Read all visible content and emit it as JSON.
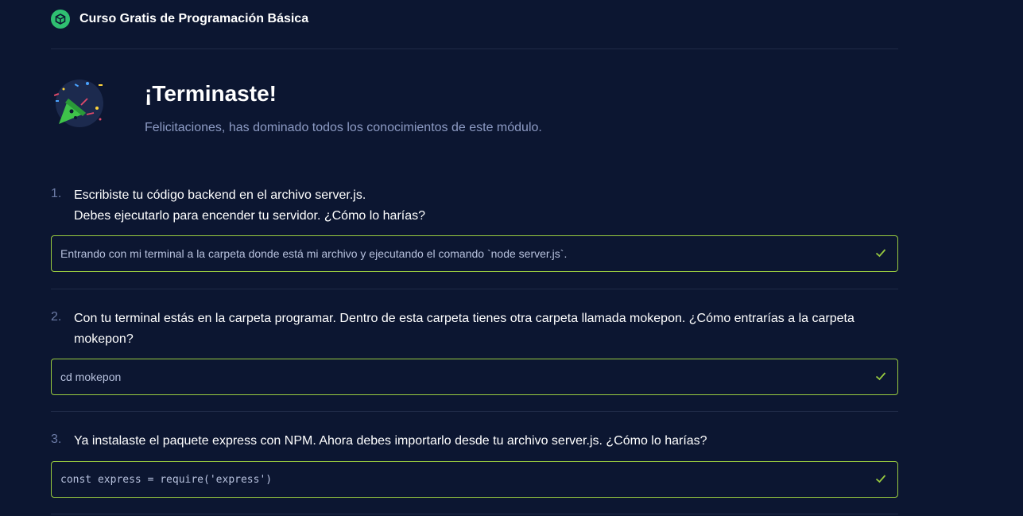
{
  "header": {
    "course_title": "Curso Gratis de Programación Básica",
    "logo_icon": "platzi-cube-icon",
    "accent": "#2fbf71"
  },
  "hero": {
    "title": "¡Terminaste!",
    "subtitle": "Felicitaciones, has dominado todos los conocimientos de este módulo.",
    "icon": "party-popper-icon"
  },
  "questions": [
    {
      "number": "1.",
      "lines": [
        "Escribiste tu código backend en el archivo server.js.",
        "Debes ejecutarlo para encender tu servidor. ¿Cómo lo harías?"
      ],
      "answer": "Entrando con mi terminal a la carpeta donde está mi archivo y ejecutando el comando `node server.js`.",
      "status": "correct"
    },
    {
      "number": "2.",
      "lines": [
        "Con tu terminal estás en la carpeta programar. Dentro de esta carpeta tienes otra carpeta llamada mokepon. ¿Cómo entrarías a la carpeta",
        "mokepon?"
      ],
      "answer": "cd mokepon",
      "status": "correct"
    },
    {
      "number": "3.",
      "lines": [
        "Ya instalaste el paquete express con NPM. Ahora debes importarlo desde tu archivo server.js. ¿Cómo lo harías?"
      ],
      "answer": "const express = require('express')",
      "status": "correct"
    }
  ],
  "colors": {
    "background": "#0c1631",
    "correct_border": "#98ca3f",
    "check": "#98ca3f",
    "muted_text": "#8d9bc4"
  }
}
